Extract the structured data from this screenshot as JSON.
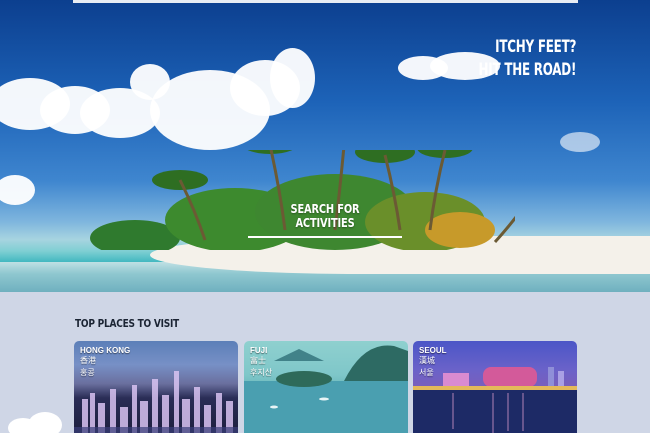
{
  "hero": {
    "tagline_line1": "ITCHY FEET?",
    "tagline_line2": "HIT THE ROAD!",
    "search_label": "SEARCH FOR ACTIVITIES"
  },
  "places": {
    "title": "TOP PLACES TO VISIT",
    "cards": [
      {
        "name": "HONG KONG",
        "local1": "香港",
        "local2": "홍콩"
      },
      {
        "name": "FUJI",
        "local1": "富士",
        "local2": "후지산"
      },
      {
        "name": "SEOUL",
        "local1": "漢城",
        "local2": "서울"
      }
    ]
  }
}
